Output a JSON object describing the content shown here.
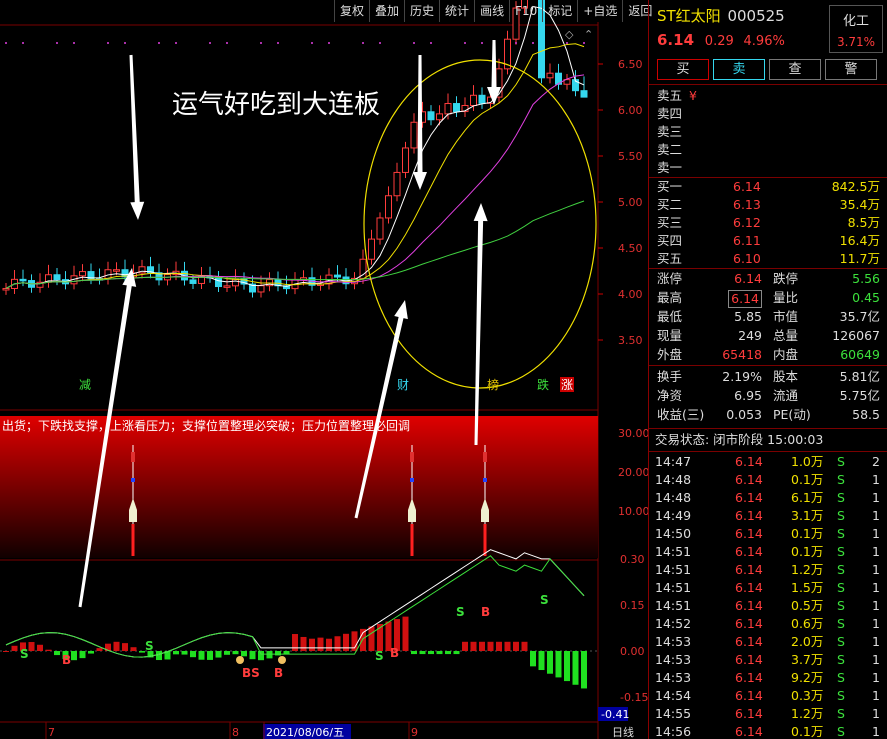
{
  "toolbar": [
    "复权",
    "叠加",
    "历史",
    "统计",
    "画线",
    "F10",
    "标记",
    "+自选",
    "返回"
  ],
  "stock": {
    "name": "ST红太阳",
    "code": "000525",
    "price": "6.14",
    "change": "0.29",
    "pct": "4.96%",
    "sector": "化工",
    "sector_pct": "3.71%"
  },
  "buttons": [
    "买",
    "卖",
    "查",
    "警"
  ],
  "sell_levels": [
    {
      "label": "卖五",
      "price": "¥",
      "vol": ""
    },
    {
      "label": "卖四",
      "price": "",
      "vol": ""
    },
    {
      "label": "卖三",
      "price": "",
      "vol": ""
    },
    {
      "label": "卖二",
      "price": "",
      "vol": ""
    },
    {
      "label": "卖一",
      "price": "",
      "vol": ""
    }
  ],
  "buy_levels": [
    {
      "label": "买一",
      "price": "6.14",
      "vol": "842.5万"
    },
    {
      "label": "买二",
      "price": "6.13",
      "vol": "35.4万"
    },
    {
      "label": "买三",
      "price": "6.12",
      "vol": "8.5万"
    },
    {
      "label": "买四",
      "price": "6.11",
      "vol": "16.4万"
    },
    {
      "label": "买五",
      "price": "6.10",
      "vol": "11.7万"
    }
  ],
  "quote": [
    {
      "l1": "涨停",
      "v1": "6.14",
      "c1": "red",
      "l2": "跌停",
      "v2": "5.56",
      "c2": "grn"
    },
    {
      "l1": "最高",
      "v1": "6.14",
      "c1": "red",
      "l2": "量比",
      "v2": "0.45",
      "c2": "grn"
    },
    {
      "l1": "最低",
      "v1": "5.85",
      "c1": "wht",
      "l2": "市值",
      "v2": "35.7亿",
      "c2": "wht"
    },
    {
      "l1": "现量",
      "v1": "249",
      "c1": "wht",
      "l2": "总量",
      "v2": "126067",
      "c2": "wht"
    },
    {
      "l1": "外盘",
      "v1": "65418",
      "c1": "red",
      "l2": "内盘",
      "v2": "60649",
      "c2": "grn"
    }
  ],
  "fundamentals": [
    {
      "l1": "换手",
      "v1": "2.19%",
      "l2": "股本",
      "v2": "5.81亿"
    },
    {
      "l1": "净资",
      "v1": "6.95",
      "l2": "流通",
      "v2": "5.75亿"
    },
    {
      "l1": "收益(三)",
      "v1": "0.053",
      "l2": "PE(动)",
      "v2": "58.5"
    }
  ],
  "trade_status": "交易状态: 闭市阶段 15:00:03",
  "ticks": [
    {
      "t": "14:47",
      "p": "6.14",
      "v": "1.0万",
      "s": "S",
      "n": "2"
    },
    {
      "t": "14:48",
      "p": "6.14",
      "v": "0.1万",
      "s": "S",
      "n": "1"
    },
    {
      "t": "14:48",
      "p": "6.14",
      "v": "6.1万",
      "s": "S",
      "n": "1"
    },
    {
      "t": "14:49",
      "p": "6.14",
      "v": "3.1万",
      "s": "S",
      "n": "1"
    },
    {
      "t": "14:50",
      "p": "6.14",
      "v": "0.1万",
      "s": "S",
      "n": "1"
    },
    {
      "t": "14:51",
      "p": "6.14",
      "v": "0.1万",
      "s": "S",
      "n": "1"
    },
    {
      "t": "14:51",
      "p": "6.14",
      "v": "1.2万",
      "s": "S",
      "n": "1"
    },
    {
      "t": "14:51",
      "p": "6.14",
      "v": "1.5万",
      "s": "S",
      "n": "1"
    },
    {
      "t": "14:51",
      "p": "6.14",
      "v": "0.5万",
      "s": "S",
      "n": "1"
    },
    {
      "t": "14:52",
      "p": "6.14",
      "v": "0.6万",
      "s": "S",
      "n": "1"
    },
    {
      "t": "14:53",
      "p": "6.14",
      "v": "2.0万",
      "s": "S",
      "n": "1"
    },
    {
      "t": "14:53",
      "p": "6.14",
      "v": "3.7万",
      "s": "S",
      "n": "1"
    },
    {
      "t": "14:53",
      "p": "6.14",
      "v": "9.2万",
      "s": "S",
      "n": "1"
    },
    {
      "t": "14:54",
      "p": "6.14",
      "v": "0.3万",
      "s": "S",
      "n": "1"
    },
    {
      "t": "14:55",
      "p": "6.14",
      "v": "1.2万",
      "s": "S",
      "n": "1"
    },
    {
      "t": "14:56",
      "p": "6.14",
      "v": "0.1万",
      "s": "S",
      "n": "1"
    }
  ],
  "annotation": "运气好吃到大连板",
  "indicator_text": "出货；下跌找支撑，上涨看压力；支撑位置整理必突破；压力位置整理必回调",
  "markers": [
    "减",
    "财",
    "榜",
    "跌",
    "涨"
  ],
  "price_ticks": [
    "6.50",
    "6.00",
    "5.50",
    "5.00",
    "4.50",
    "4.00",
    "3.50"
  ],
  "ind_ticks": [
    "30.00",
    "20.00",
    "10.00"
  ],
  "macd_ticks": [
    "0.30",
    "0.15",
    "0.00",
    "-0.15"
  ],
  "macd_value": "-0.41",
  "date_labels": [
    "7",
    "8",
    "2021/08/06/五",
    "9"
  ],
  "period": "日线",
  "signals": {
    "s": "S",
    "b": "B",
    "bs": "BS"
  },
  "colors": {
    "up": "#ff3c3c",
    "down": "#35d7ee",
    "ma5": "#ffffff",
    "ma10": "#f0e000",
    "ma20": "#e040e0",
    "ma60": "#40d040",
    "accent": "#c00000"
  }
}
